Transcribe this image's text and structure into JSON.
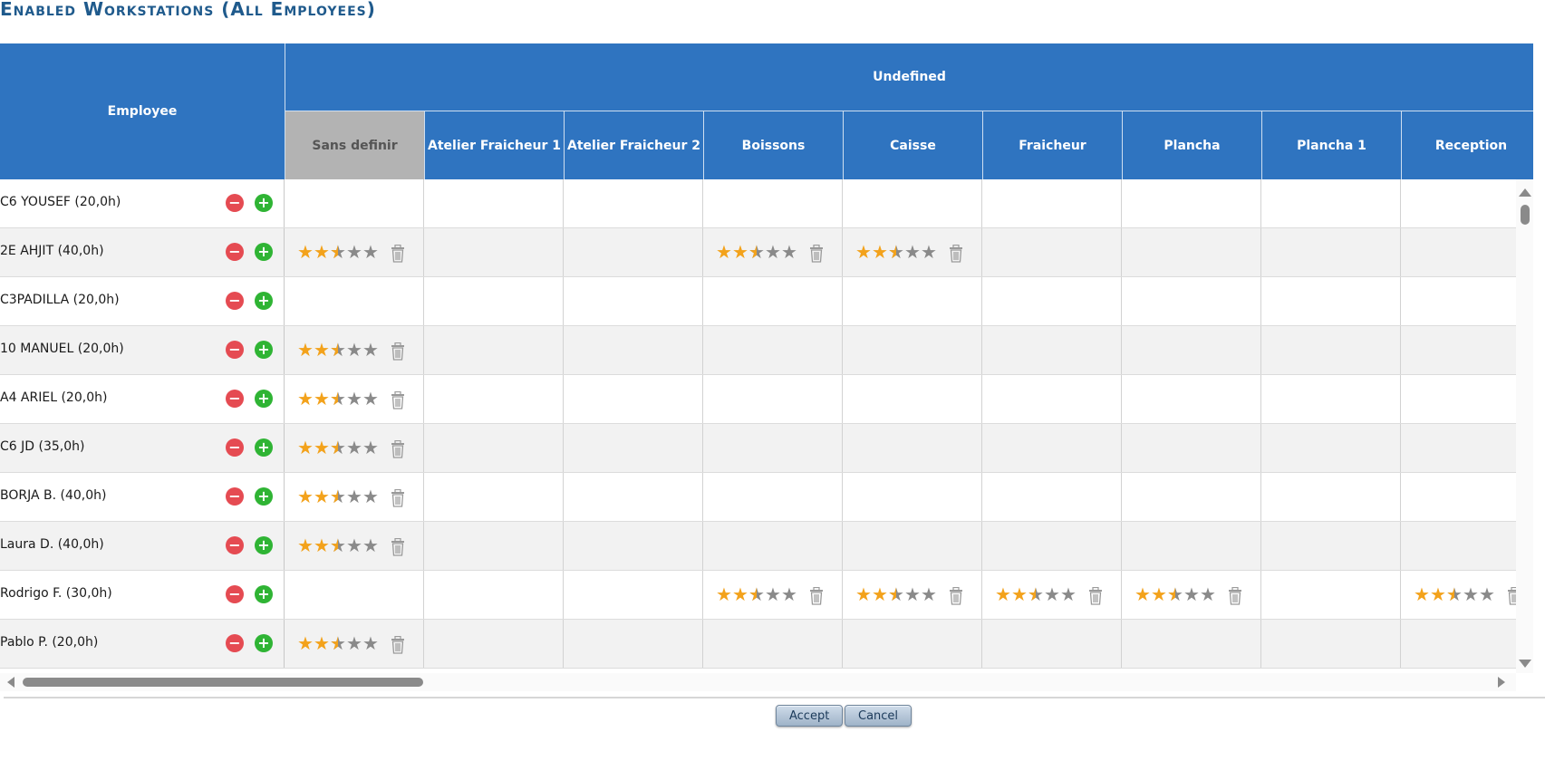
{
  "page_title": "Enabled Workstations (All Employees)",
  "table": {
    "employee_header": "Employee",
    "group_header": "Undefined",
    "workstations": [
      "Sans definir",
      "Atelier Fraicheur 1",
      "Atelier Fraicheur 2",
      "Boissons",
      "Caisse",
      "Fraicheur",
      "Plancha",
      "Plancha 1",
      "Reception"
    ],
    "rows": [
      {
        "name": "C6 YOUSEF (20,0h)",
        "assigned": []
      },
      {
        "name": "2E AHJIT (40,0h)",
        "assigned": [
          0,
          3,
          4
        ]
      },
      {
        "name": "C3PADILLA (20,0h)",
        "assigned": []
      },
      {
        "name": "10 MANUEL (20,0h)",
        "assigned": [
          0
        ]
      },
      {
        "name": "A4 ARIEL (20,0h)",
        "assigned": [
          0
        ]
      },
      {
        "name": "C6 JD (35,0h)",
        "assigned": [
          0
        ]
      },
      {
        "name": "BORJA B. (40,0h)",
        "assigned": [
          0
        ]
      },
      {
        "name": "Laura D. (40,0h)",
        "assigned": [
          0
        ]
      },
      {
        "name": "Rodrigo F. (30,0h)",
        "assigned": [
          3,
          4,
          5,
          6,
          8
        ]
      },
      {
        "name": "Pablo P. (20,0h)",
        "assigned": [
          0
        ]
      }
    ],
    "rating": {
      "max": 5,
      "value": 2.5
    },
    "icons": {
      "remove": "remove-circle-icon",
      "add": "add-circle-icon",
      "delete": "trash-icon",
      "star": "star-icon"
    }
  },
  "colors": {
    "header": "#2f74c0",
    "header_disabled": "#b3b3b3",
    "star_on": "#f3a21b",
    "star_off": "#8a8a8a",
    "remove": "#e54b52",
    "add": "#2fb434",
    "title": "#1f5a8c"
  },
  "buttons": {
    "accept": "Accept",
    "cancel": "Cancel"
  }
}
